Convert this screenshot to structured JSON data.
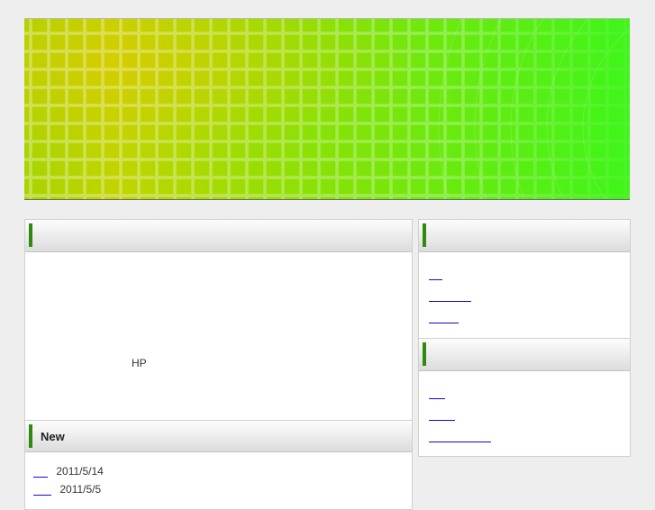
{
  "main": {
    "intro_panel": {
      "title": "",
      "body_text": "HP"
    },
    "news_panel": {
      "title": "New",
      "items": [
        {
          "link": "",
          "date": "2011/5/14"
        },
        {
          "link": "",
          "date": "2011/5/5"
        }
      ]
    }
  },
  "sidebar": {
    "panel1": {
      "title": "",
      "links": [
        "",
        "",
        ""
      ]
    },
    "panel2": {
      "title": "",
      "links": [
        "",
        "",
        ""
      ]
    }
  },
  "colors": {
    "accent_bar": "#2e8b0e",
    "link": "#2200cc",
    "banner_start": "#b9d600",
    "banner_end": "#3df21b"
  }
}
